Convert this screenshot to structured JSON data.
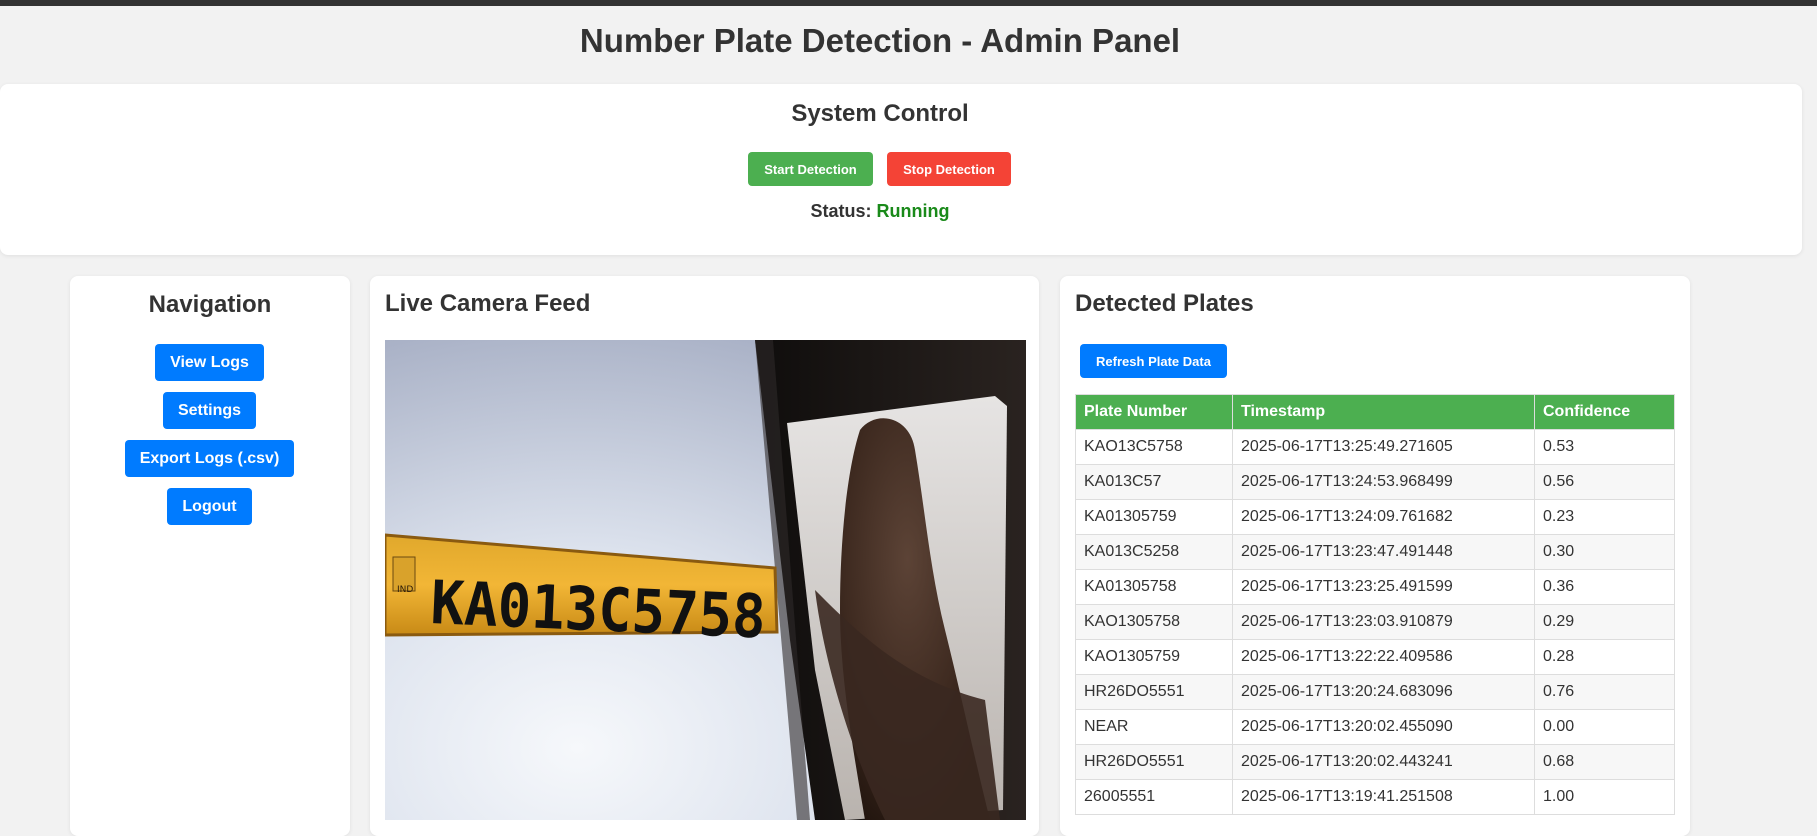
{
  "page": {
    "title": "Number Plate Detection - Admin Panel"
  },
  "system_control": {
    "title": "System Control",
    "start_label": "Start Detection",
    "stop_label": "Stop Detection",
    "status_label": "Status:",
    "status_value": "Running",
    "status_color": "#1a8a1a"
  },
  "navigation": {
    "title": "Navigation",
    "items": [
      {
        "label": "View Logs"
      },
      {
        "label": "Settings"
      },
      {
        "label": "Export Logs (.csv)"
      },
      {
        "label": "Logout"
      }
    ]
  },
  "camera": {
    "title": "Live Camera Feed",
    "plate_text": "KA013C5758",
    "plate_small_text": "IND"
  },
  "plates": {
    "title": "Detected Plates",
    "refresh_label": "Refresh Plate Data",
    "columns": [
      "Plate Number",
      "Timestamp",
      "Confidence"
    ],
    "rows": [
      [
        "KAO13C5758",
        "2025-06-17T13:25:49.271605",
        "0.53"
      ],
      [
        "KA013C57",
        "2025-06-17T13:24:53.968499",
        "0.56"
      ],
      [
        "KA01305759",
        "2025-06-17T13:24:09.761682",
        "0.23"
      ],
      [
        "KA013C5258",
        "2025-06-17T13:23:47.491448",
        "0.30"
      ],
      [
        "KA01305758",
        "2025-06-17T13:23:25.491599",
        "0.36"
      ],
      [
        "KAO1305758",
        "2025-06-17T13:23:03.910879",
        "0.29"
      ],
      [
        "KAO1305759",
        "2025-06-17T13:22:22.409586",
        "0.28"
      ],
      [
        "HR26DO5551",
        "2025-06-17T13:20:24.683096",
        "0.76"
      ],
      [
        "NEAR",
        "2025-06-17T13:20:02.455090",
        "0.00"
      ],
      [
        "HR26DO5551",
        "2025-06-17T13:20:02.443241",
        "0.68"
      ],
      [
        "26005551",
        "2025-06-17T13:19:41.251508",
        "1.00"
      ]
    ]
  },
  "colors": {
    "accent_blue": "#007bff",
    "start_green": "#4caf50",
    "stop_red": "#f44336",
    "table_header": "#4caf50"
  }
}
